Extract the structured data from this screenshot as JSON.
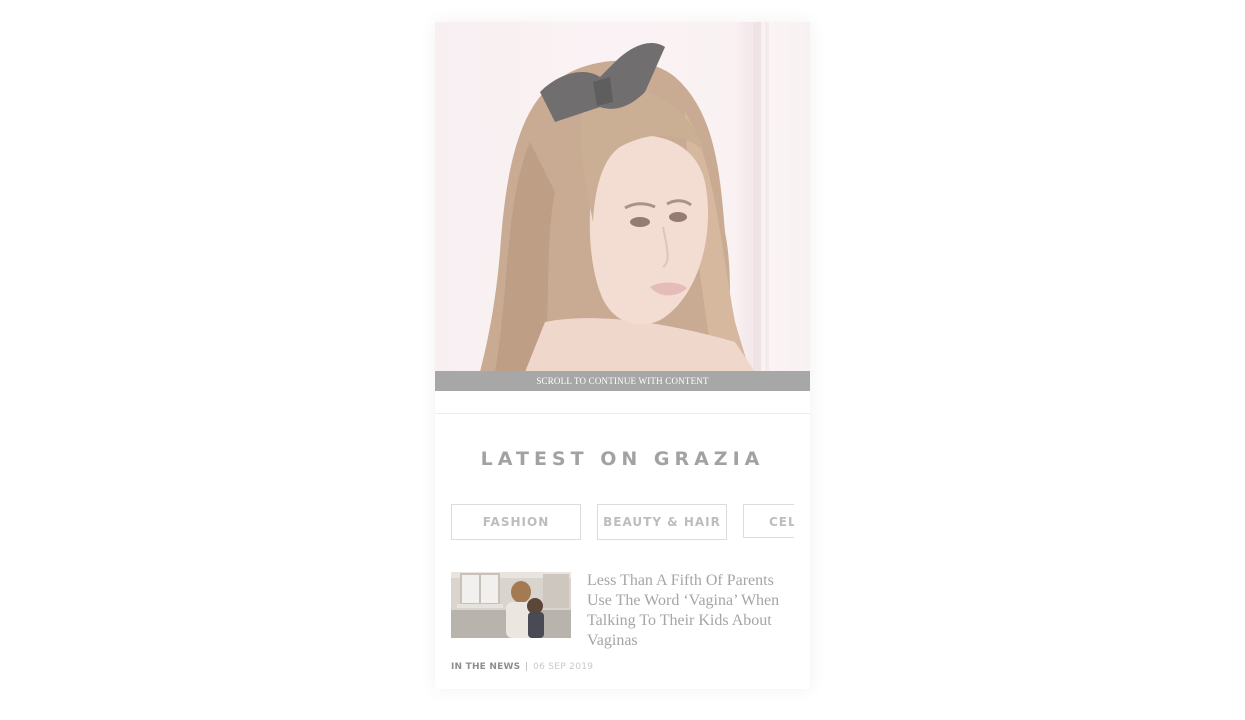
{
  "hero": {
    "overlay_text": "SCROLL TO CONTINUE WITH CONTENT"
  },
  "section": {
    "title": "LATEST ON GRAZIA"
  },
  "tabs": [
    {
      "label": "FASHION"
    },
    {
      "label": "BEAUTY & HAIR"
    },
    {
      "label": "CEL"
    }
  ],
  "article": {
    "headline": "Less Than A Fifth Of Parents Use The Word ‘Vagina’ When Talking To Their Kids About Vaginas",
    "category": "IN THE NEWS",
    "separator": "|",
    "date": "06 SEP 2019"
  },
  "colors": {
    "title": "#a2a2a2",
    "tab_text": "#bdbdbd",
    "tab_border": "#dcdcdc",
    "overlay_bar": "#a7a7a7",
    "headline": "#a5a5a5"
  }
}
